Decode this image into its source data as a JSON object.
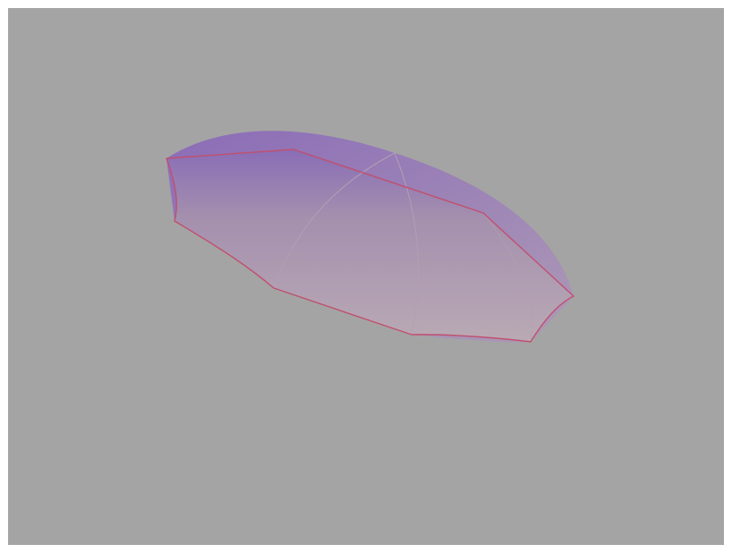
{
  "viewport": {
    "background": "#a4a4a4",
    "object": {
      "name": "umbrella-canopy",
      "colors": {
        "top": "#8c70b4",
        "mid": "#a691ac",
        "bottom": "#b6a7b2",
        "edge": "#c0506e",
        "rib": "#b8a4b4"
      }
    }
  }
}
